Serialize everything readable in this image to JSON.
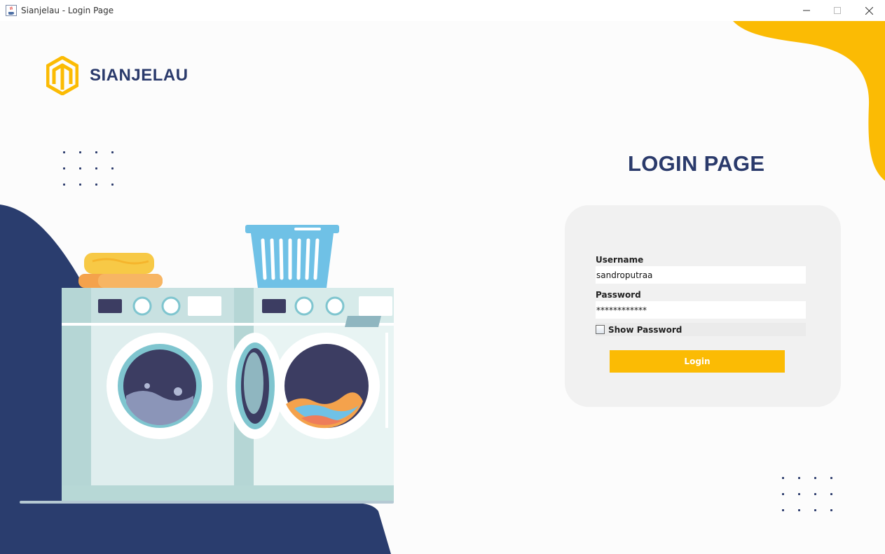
{
  "window": {
    "title": "Sianjelau - Login Page",
    "icon": "java-cup-icon",
    "controls": [
      "minimize-icon",
      "maximize-icon",
      "close-icon"
    ]
  },
  "brand": {
    "name": "SIANJELAU",
    "logo_icon": "hexagon-m-logo-icon"
  },
  "login": {
    "title": "LOGIN PAGE",
    "username_label": "Username",
    "username_value": "sandroputraa",
    "password_label": "Password",
    "password_value": "************",
    "show_password_label": "Show Password",
    "show_password_checked": false,
    "submit_label": "Login"
  },
  "colors": {
    "accent_yellow": "#fbbb04",
    "navy": "#2a3a6b",
    "card_bg": "#f1f1f1"
  }
}
